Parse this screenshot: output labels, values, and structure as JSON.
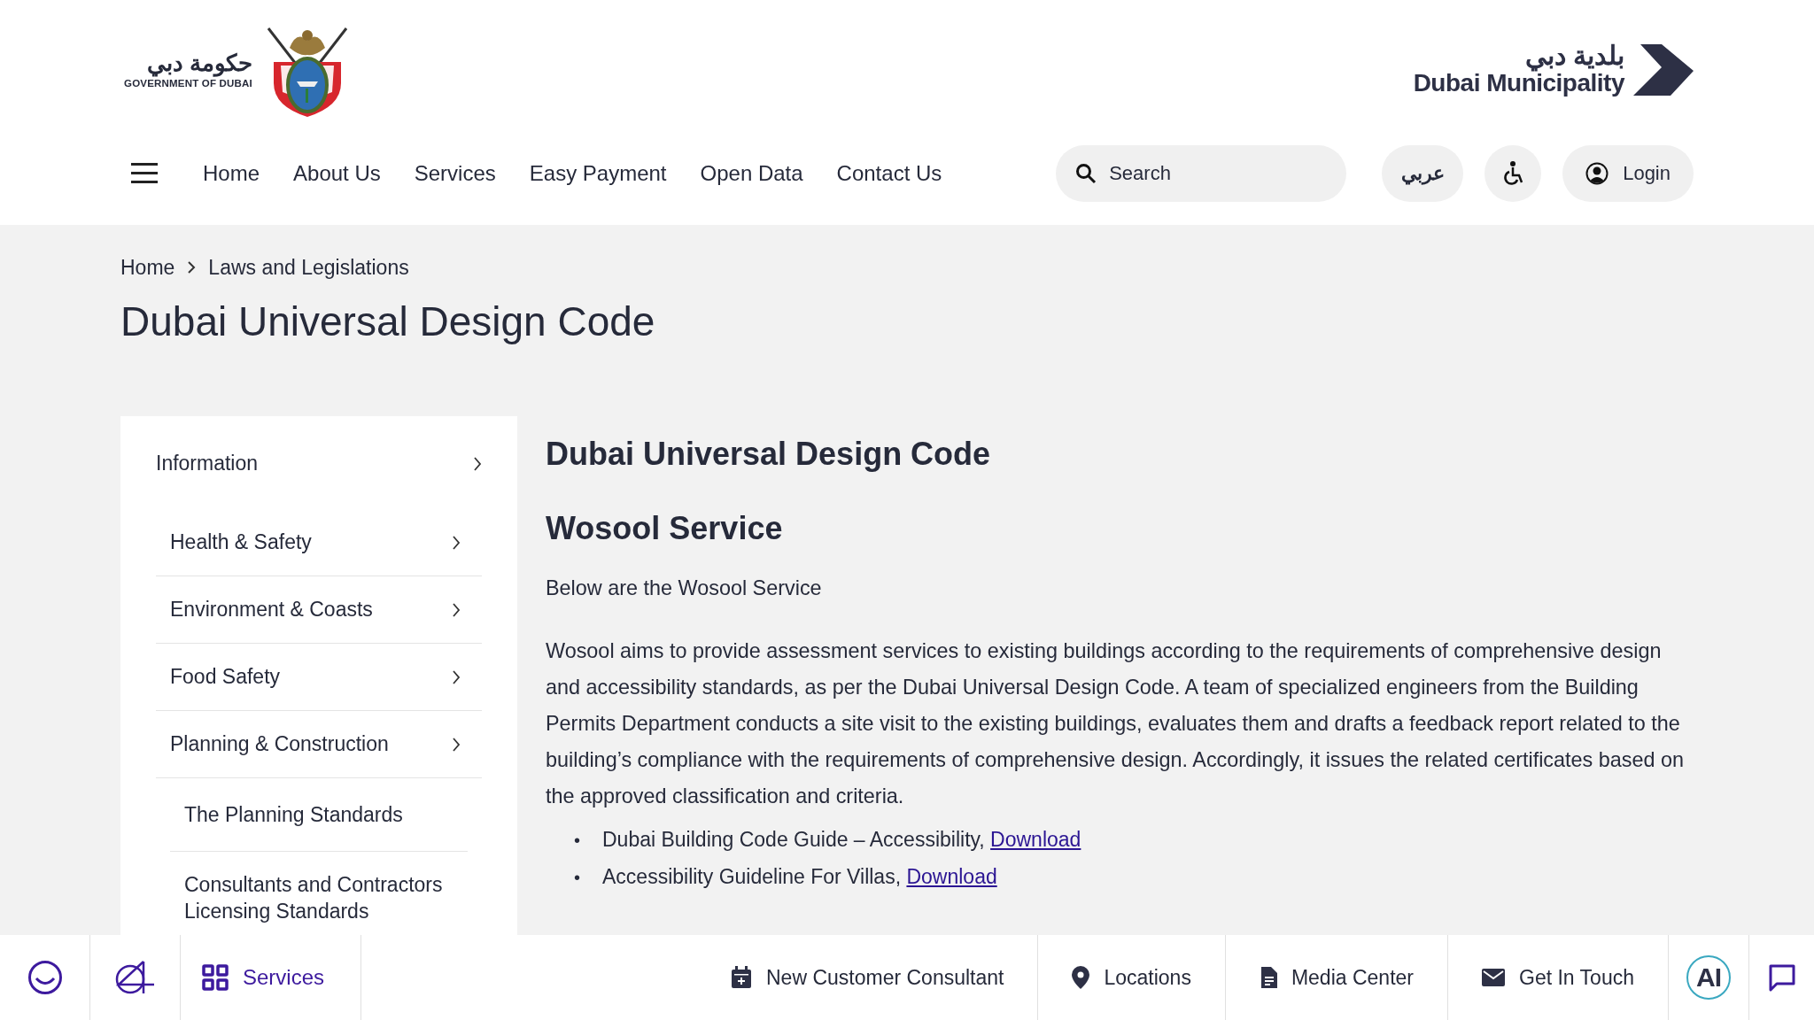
{
  "header": {
    "gov_logo": {
      "arabic": "حكومة دبي",
      "english": "GOVERNMENT OF DUBAI"
    },
    "dm_logo": {
      "arabic": "بلدية دبي",
      "english": "Dubai Municipality"
    },
    "nav": [
      {
        "label": "Home"
      },
      {
        "label": "About Us"
      },
      {
        "label": "Services"
      },
      {
        "label": "Easy Payment"
      },
      {
        "label": "Open Data"
      },
      {
        "label": "Contact Us"
      }
    ],
    "search": {
      "placeholder": "Search"
    },
    "language": "عربي",
    "login": "Login"
  },
  "breadcrumb": [
    {
      "label": "Home"
    },
    {
      "label": "Laws and Legislations"
    }
  ],
  "page_title": "Dubai Universal Design Code",
  "sidebar": {
    "items": [
      {
        "label": "Information",
        "children": [
          {
            "label": "Health & Safety"
          },
          {
            "label": "Environment & Coasts"
          },
          {
            "label": "Food Safety"
          },
          {
            "label": "Planning & Construction",
            "children": [
              {
                "label": "The Planning Standards"
              },
              {
                "label": "Consultants and Contractors Licensing Standards"
              }
            ]
          }
        ]
      }
    ]
  },
  "article": {
    "heading": "Dubai Universal Design Code",
    "subheading": "Wosool Service",
    "intro": "Below are the Wosool Service",
    "paragraph": "Wosool aims to provide assessment services to existing buildings according to the requirements of comprehensive design and accessibility standards, as per the Dubai Universal Design Code. A team of specialized engineers from the Building Permits Department conducts a site visit to the existing buildings, evaluates them and drafts a feedback report related to the building’s compliance  with the requirements of comprehensive design. Accordingly, it issues the related certificates based on the approved classification and criteria.",
    "downloads": [
      {
        "marker": "•",
        "text": "Dubai Building Code Guide – Accessibility,",
        "link": "Download"
      },
      {
        "marker": "•",
        "text": "Accessibility Guideline For Villas,",
        "link": "Download"
      }
    ]
  },
  "bottom_bar": {
    "services": "Services",
    "items": [
      {
        "kind": "calendar",
        "label": "New Customer Consultant"
      },
      {
        "kind": "location",
        "label": "Locations"
      },
      {
        "kind": "document",
        "label": "Media Center"
      },
      {
        "kind": "mail",
        "label": "Get In Touch"
      }
    ],
    "ai": "AI"
  }
}
